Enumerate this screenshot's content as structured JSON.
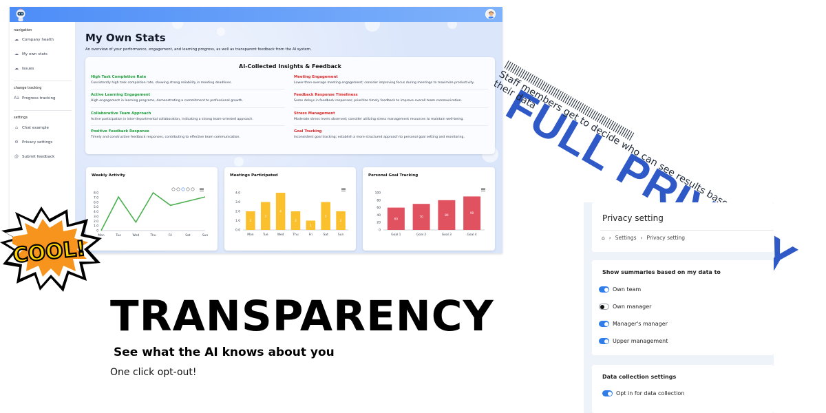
{
  "dashboard": {
    "sidebar": {
      "sections": [
        {
          "label": "navigation"
        },
        {
          "label": "change tracking"
        },
        {
          "label": "settings"
        }
      ],
      "items": [
        {
          "label": "Company health",
          "icon": "cloud-icon"
        },
        {
          "label": "My own stats",
          "icon": "cloud-icon"
        },
        {
          "label": "Issues",
          "icon": "cloud-icon"
        },
        {
          "label": "Progress tracking",
          "icon": "text-size-icon"
        },
        {
          "label": "Chat example",
          "icon": "home-icon"
        },
        {
          "label": "Privacy settings",
          "icon": "gear-icon"
        },
        {
          "label": "Submit feedback",
          "icon": "at-icon"
        }
      ]
    },
    "title": "My Own Stats",
    "subtitle": "An overview of your performance, engagement, and learning progress, as well as transparent feedback from the AI system.",
    "insights": {
      "title": "AI-Collected Insights & Feedback",
      "positive": [
        {
          "title": "High Task Completion Rate",
          "desc": "Consistently high task completion rate, showing strong reliability in meeting deadlines."
        },
        {
          "title": "Active Learning Engagement",
          "desc": "High engagement in learning programs, demonstrating a commitment to professional growth."
        },
        {
          "title": "Collaborative Team Approach",
          "desc": "Active participation in inter-departmental collaboration, indicating a strong team-oriented approach."
        },
        {
          "title": "Positive Feedback Response",
          "desc": "Timely and constructive feedback responses, contributing to effective team communication."
        }
      ],
      "negative": [
        {
          "title": "Meeting Engagement",
          "desc": "Lower-than-average meeting engagement; consider improving focus during meetings to maximize productivity."
        },
        {
          "title": "Feedback Response Timeliness",
          "desc": "Some delays in feedback responses; prioritize timely feedback to improve overall team communication."
        },
        {
          "title": "Stress Management",
          "desc": "Moderate stress levels observed; consider utilizing stress management resources to maintain well-being."
        },
        {
          "title": "Goal Tracking",
          "desc": "Inconsistent goal tracking; establish a more structured approach to personal goal setting and monitoring."
        }
      ]
    },
    "colors": {
      "positive": "#1f9d3a",
      "negative": "#dc2626",
      "line": "#4caf50",
      "bar_yellow": "#fbc02d",
      "bar_red": "#e05260"
    }
  },
  "chart_data": [
    {
      "type": "line",
      "title": "Weekly Activity",
      "categories": [
        "Mon",
        "Tue",
        "Wed",
        "Thu",
        "Fri",
        "Sat",
        "Sun"
      ],
      "values": [
        0.0,
        8.0,
        2.0,
        9.0,
        6.0,
        7.0,
        8.0
      ],
      "y_ticks": [
        "8.0",
        "7.0",
        "6.0",
        "5.0",
        "4.0",
        "3.0",
        "2.0",
        "1.0",
        "0"
      ],
      "ylim": [
        0,
        9
      ]
    },
    {
      "type": "bar",
      "title": "Meetings Participated",
      "categories": [
        "Mon",
        "Tue",
        "Wed",
        "Thu",
        "Fri",
        "Sat",
        "Sun"
      ],
      "values": [
        2,
        3,
        4,
        2,
        1,
        3,
        2
      ],
      "y_ticks": [
        "4.0",
        "3.0",
        "2.0",
        "1.0",
        "0.0"
      ],
      "ylim": [
        0,
        4
      ]
    },
    {
      "type": "bar",
      "title": "Personal Goal Tracking",
      "categories": [
        "Goal 1",
        "Goal 2",
        "Goal 3",
        "Goal 4"
      ],
      "values": [
        60,
        70,
        80,
        90
      ],
      "y_ticks": [
        "100",
        "80",
        "60",
        "40",
        "20",
        "0"
      ],
      "ylim": [
        0,
        100
      ]
    }
  ],
  "privacy_banner": {
    "title": "FULL PRIVACY",
    "text": "Staff members get to decide who can see results based on their data",
    "bars": "|||||||||||||||||||||||||||||||||||||||||||||||||||||||||||||||"
  },
  "cool": {
    "text": "COOL!"
  },
  "transparency": {
    "title": "TRANSPARENCY",
    "subtitle": "See what the AI knows about you",
    "optout": "One click opt-out!"
  },
  "privacy_setting": {
    "title": "Privacy setting",
    "breadcrumb": [
      "Settings",
      "Privacy setting"
    ],
    "share_title": "Show summaries based on my data to",
    "share_options": [
      {
        "label": "Own team",
        "on": true
      },
      {
        "label": "Own manager",
        "on": false
      },
      {
        "label": "Manager's manager",
        "on": true
      },
      {
        "label": "Upper management",
        "on": true
      }
    ],
    "collection_title": "Data collection settings",
    "collection_options": [
      {
        "label": "Opt in for data collection",
        "on": true
      }
    ]
  }
}
